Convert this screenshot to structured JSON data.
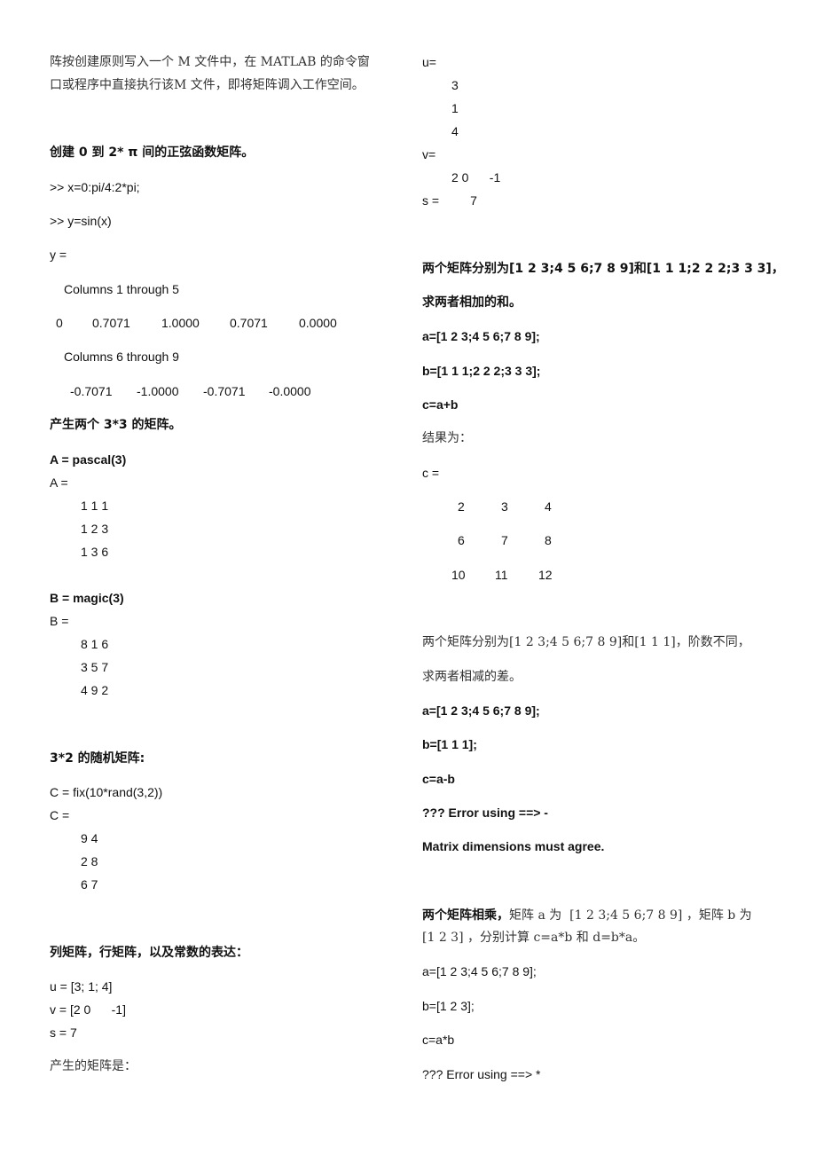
{
  "left": {
    "intro": {
      "line1": "阵按创建原则写入一个 M 文件中，在 MATLAB 的命令窗",
      "line2": "口或程序中直接执行该M 文件，即将矩阵调入工作空间。"
    },
    "sine": {
      "heading": "创建 0 到 2* π 间的正弦函数矩阵。",
      "cmd1": ">> x=0:pi/4:2*pi;",
      "cmd2": ">> y=sin(x)",
      "out_label": "y =",
      "cols1_label": "Columns 1 through 5",
      "cols1_values": [
        "0",
        "0.7071",
        "1.0000",
        "0.7071",
        "0.0000"
      ],
      "cols2_label": "Columns 6 through 9",
      "cols2_values": [
        "-0.7071",
        "-1.0000",
        "-0.7071",
        "-0.0000"
      ]
    },
    "three_by_three": {
      "heading": "产生两个 3*3 的矩阵。",
      "a_cmd": "A = pascal(3)",
      "a_label": "A =",
      "a_rows": [
        "1 1 1",
        "1 2 3",
        "1 3 6"
      ],
      "b_cmd": "B = magic(3)",
      "b_label": "B =",
      "b_rows": [
        "8 1 6",
        "3 5 7",
        "4 9 2"
      ]
    },
    "random": {
      "heading": "3*2 的随机矩阵:",
      "cmd": "C = fix(10*rand(3,2))",
      "label": "C =",
      "rows": [
        "9 4",
        "2 8",
        "6 7"
      ]
    },
    "vectors": {
      "heading": "列矩阵，行矩阵，以及常数的表达：",
      "u": "u = [3; 1; 4]",
      "v": "v = [2 0      -1]",
      "s": "s = 7",
      "result_label": "产生的矩阵是："
    }
  },
  "right": {
    "vector_output": {
      "u_label": "u=",
      "u_values": [
        "3",
        "1",
        "4"
      ],
      "v_label": "v=",
      "v_values": "2 0      -1",
      "s_line": "s =         7"
    },
    "addition": {
      "heading1": "两个矩阵分别为[1 2 3;4 5 6;7 8 9]和[1 1 1;2 2 2;3 3 3]，",
      "heading2": "求两者相加的和。",
      "a_cmd": "a=[1 2 3;4 5 6;7 8 9];",
      "b_cmd": "b=[1 1 1;2 2 2;3 3 3];",
      "c_cmd": "c=a+b",
      "result_label": "结果为：",
      "c_label": "c =",
      "c_rows": [
        [
          "2",
          "3",
          "4"
        ],
        [
          "6",
          "7",
          "8"
        ],
        [
          "10",
          "11",
          "12"
        ]
      ]
    },
    "subtraction": {
      "heading1": "两个矩阵分别为[1 2 3;4 5 6;7 8 9]和[1 1 1]，阶数不同，",
      "heading2": "求两者相减的差。",
      "a_cmd": "a=[1 2 3;4 5 6;7 8 9];",
      "b_cmd": "b=[1 1 1];",
      "c_cmd": "c=a-b",
      "error1": "??? Error using ==> -",
      "error2": "Matrix dimensions must agree."
    },
    "multiplication": {
      "heading_bold": "两个矩阵相乘，",
      "heading_rest": "矩阵 a 为  [1 2 3;4 5 6;7 8 9] ，矩阵 b 为",
      "heading2": "[1 2 3] ，分别计算 c=a*b 和 d=b*a。",
      "a_cmd": "a=[1 2 3;4 5 6;7 8 9];",
      "b_cmd": "b=[1 2 3];",
      "c_cmd": "c=a*b",
      "error1": "??? Error using ==> *"
    }
  }
}
